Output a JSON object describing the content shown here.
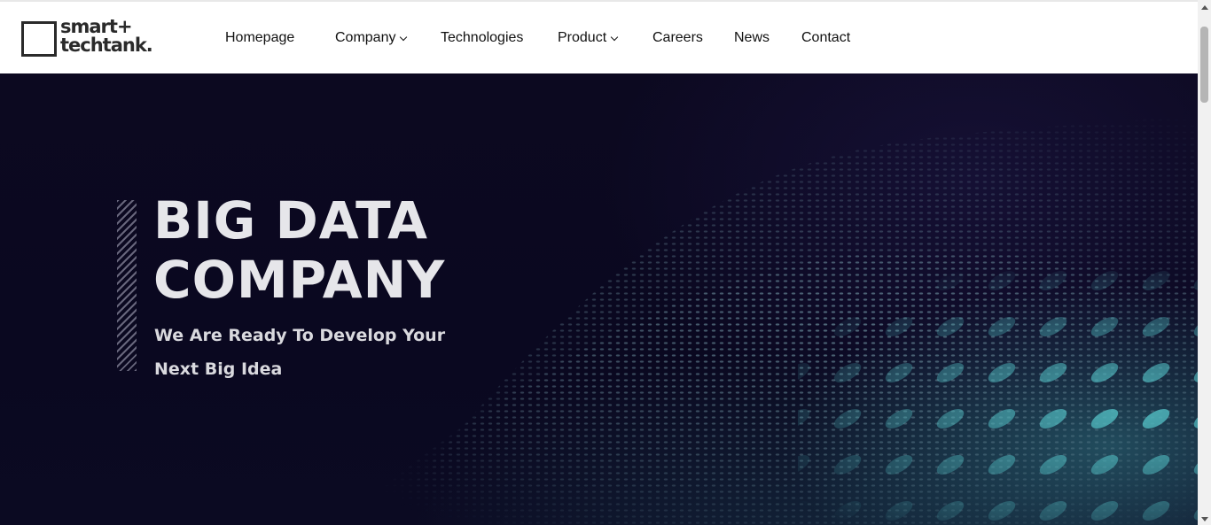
{
  "header": {
    "logo": {
      "line1": "smart+",
      "line2": "techtank."
    },
    "nav": [
      {
        "label": "Homepage",
        "has_dropdown": false
      },
      {
        "label": "Company",
        "has_dropdown": true
      },
      {
        "label": "Technologies",
        "has_dropdown": false
      },
      {
        "label": "Product",
        "has_dropdown": true
      },
      {
        "label": "Careers",
        "has_dropdown": false
      },
      {
        "label": "News",
        "has_dropdown": false
      },
      {
        "label": "Contact",
        "has_dropdown": false
      }
    ]
  },
  "hero": {
    "title_line1": "BIG DATA",
    "title_line2": "COMPANY",
    "subtitle_line1": "We Are Ready To Develop Your",
    "subtitle_line2": "Next Big Idea"
  },
  "colors": {
    "hero_background": "#0c0920",
    "accent_teal": "#3c96a0",
    "nav_text": "#111111"
  }
}
